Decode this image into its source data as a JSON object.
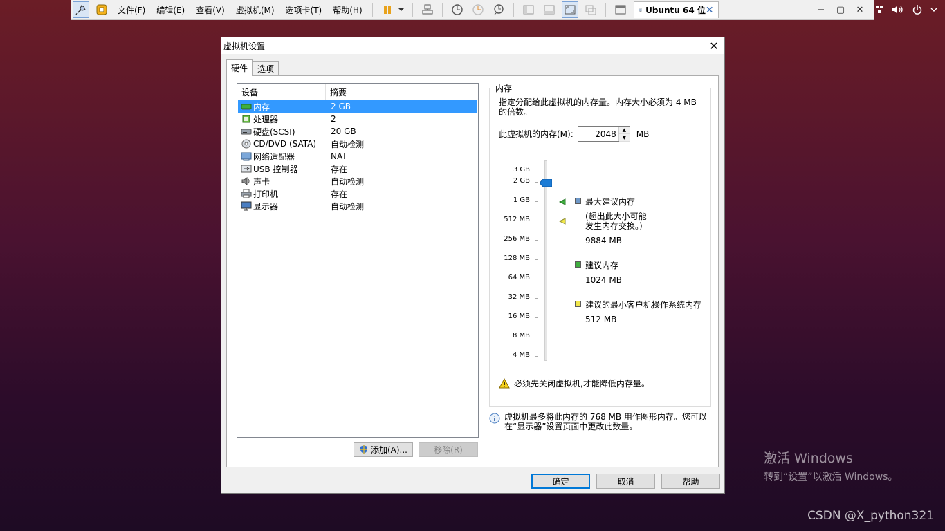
{
  "toolbar": {
    "menus": [
      "文件(F)",
      "编辑(E)",
      "查看(V)",
      "虚拟机(M)",
      "选项卡(T)",
      "帮助(H)"
    ],
    "vm_tab_label": "Ubuntu 64 位",
    "tab_close": "✕"
  },
  "window_controls": {
    "minimize": "−",
    "restore": "▢",
    "close": "✕"
  },
  "dialog": {
    "title": "虚拟机设置",
    "close": "✕",
    "tabs": [
      "硬件",
      "选项"
    ],
    "device_list": {
      "headers": {
        "device": "设备",
        "summary": "摘要"
      },
      "rows": [
        {
          "device": "内存",
          "summary": "2 GB",
          "icon": "memory-icon"
        },
        {
          "device": "处理器",
          "summary": "2",
          "icon": "cpu-icon"
        },
        {
          "device": "硬盘(SCSI)",
          "summary": "20 GB",
          "icon": "harddisk-icon"
        },
        {
          "device": "CD/DVD (SATA)",
          "summary": "自动检测",
          "icon": "cd-icon"
        },
        {
          "device": "网络适配器",
          "summary": "NAT",
          "icon": "network-icon"
        },
        {
          "device": "USB 控制器",
          "summary": "存在",
          "icon": "usb-icon"
        },
        {
          "device": "声卡",
          "summary": "自动检测",
          "icon": "sound-icon"
        },
        {
          "device": "打印机",
          "summary": "存在",
          "icon": "printer-icon"
        },
        {
          "device": "显示器",
          "summary": "自动检测",
          "icon": "display-icon"
        }
      ],
      "selected_index": 0
    },
    "add_button": "添加(A)...",
    "remove_button": "移除(R)",
    "memory": {
      "group_title": "内存",
      "description": "指定分配给此虚拟机的内存量。内存大小必须为 4 MB 的倍数。",
      "input_label": "此虚拟机的内存(M):",
      "input_value": "2048",
      "unit": "MB",
      "scale": [
        "3 GB",
        "2 GB",
        "1 GB",
        "512 MB",
        "256 MB",
        "128 MB",
        "64 MB",
        "32 MB",
        "16 MB",
        "8 MB",
        "4 MB"
      ],
      "legend": {
        "max_label": "最大建议内存",
        "max_note": "(超出此大小可能发生内存交换。)",
        "max_value": "9884 MB",
        "rec_label": "建议内存",
        "rec_value": "1024 MB",
        "min_label": "建议的最小客户机操作系统内存",
        "min_value": "512 MB"
      },
      "warning": "必须先关闭虚拟机,才能降低内存量。",
      "info": "虚拟机最多将此内存的 768 MB 用作图形内存。您可以在“显示器”设置页面中更改此数量。",
      "colors": {
        "max": "#6e98c8",
        "rec": "#3fae3f",
        "min": "#f0e64a",
        "thumb": "#1c7cd6"
      }
    },
    "buttons": {
      "ok": "确定",
      "cancel": "取消",
      "help": "帮助"
    }
  },
  "watermark": {
    "activate_title": "激活 Windows",
    "activate_sub": "转到“设置”以激活 Windows。",
    "csdn": "CSDN @X_python321"
  }
}
